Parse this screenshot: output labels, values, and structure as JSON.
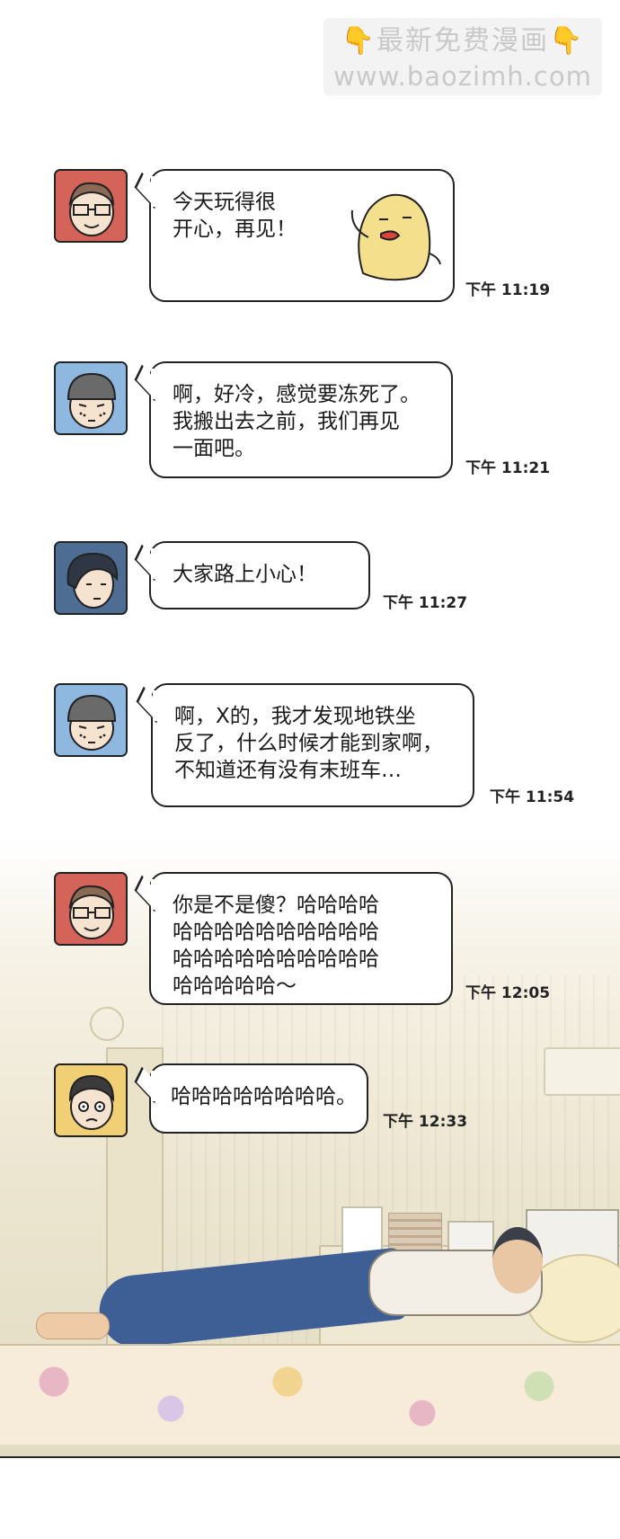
{
  "watermark": {
    "title": "最新免费漫画",
    "url": "www.baozimh.com",
    "hand": "👇"
  },
  "messages": [
    {
      "avatar": "glasses-guy-red",
      "text": "今天玩得很\n开心，再见！",
      "time": "下午 11:19",
      "sticker": "chick-sticker"
    },
    {
      "avatar": "beanie-guy-blue",
      "text": "啊，好冷，感觉要冻死了。\n我搬出去之前，我们再见\n一面吧。",
      "time": "下午 11:21"
    },
    {
      "avatar": "dark-hair-guy-navy",
      "text": "大家路上小心！",
      "time": "下午 11:27"
    },
    {
      "avatar": "beanie-guy-blue",
      "text": "啊，X的，我才发现地铁坐\n反了，什么时候才能到家啊，\n不知道还有没有末班车…",
      "time": "下午 11:54"
    },
    {
      "avatar": "glasses-guy-red",
      "text": "你是不是傻？哈哈哈哈\n哈哈哈哈哈哈哈哈哈哈\n哈哈哈哈哈哈哈哈哈哈\n哈哈哈哈哈～",
      "time": "下午 12:05"
    },
    {
      "avatar": "surprised-guy-yellow",
      "text": "哈哈哈哈哈哈哈哈。",
      "time": "下午 12:33"
    }
  ],
  "colors": {
    "avatar_red": "#d4635a",
    "avatar_blue": "#8fb8e0",
    "avatar_navy": "#4d6d93",
    "avatar_yellow": "#f1cf74",
    "chick": "#f3df8c"
  }
}
